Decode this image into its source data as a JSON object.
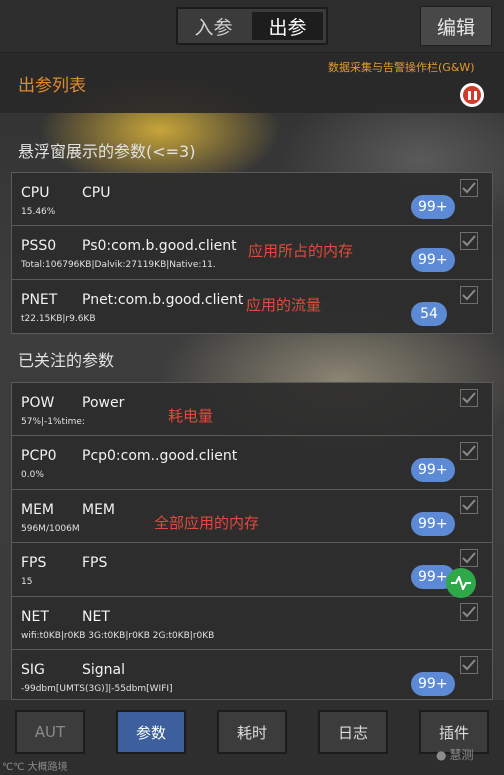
{
  "topbar": {
    "tabs": [
      {
        "label": "入参",
        "active": false
      },
      {
        "label": "出参",
        "active": true
      }
    ],
    "edit_label": "编辑"
  },
  "header": {
    "title": "出参列表",
    "ops_label": "数据采集与告警操作栏(G&W)"
  },
  "sections": {
    "floating": "悬浮窗展示的参数(<=3)",
    "followed": "已关注的参数"
  },
  "floating_params": [
    {
      "code": "CPU",
      "name": "CPU",
      "sub": "15.46%",
      "badge": "99+",
      "note": ""
    },
    {
      "code": "PSS0",
      "name": "Ps0:com.b.good.client",
      "sub": "Total:106796KB|Dalvik:27119KB|Native:11.",
      "badge": "99+",
      "note": "应用所占的内存"
    },
    {
      "code": "PNET",
      "name": "Pnet:com.b.good.client",
      "sub": "t22.15KB|r9.6KB",
      "badge": "54",
      "note": "应用的流量"
    }
  ],
  "followed_params": [
    {
      "code": "POW",
      "name": "Power",
      "sub": "57%|-1%time:",
      "badge": "",
      "note": "耗电量"
    },
    {
      "code": "PCP0",
      "name": "Pcp0:com..good.client",
      "sub": "0.0%",
      "badge": "99+",
      "note": ""
    },
    {
      "code": "MEM",
      "name": "MEM",
      "sub": "596M/1006M",
      "badge": "99+",
      "note": "全部应用的内存"
    },
    {
      "code": "FPS",
      "name": "FPS",
      "sub": "15",
      "badge": "99+",
      "note": ""
    },
    {
      "code": "NET",
      "name": "NET",
      "sub": "wifi:t0KB|r0KB 3G:t0KB|r0KB 2G:t0KB|r0KB",
      "badge": "",
      "note": ""
    },
    {
      "code": "SIG",
      "name": "Signal",
      "sub": "-99dbm[UMTS(3G)]|-55dbm[WIFI]",
      "badge": "99+",
      "note": ""
    }
  ],
  "bottom_tabs": [
    {
      "label": "AUT",
      "state": "dim"
    },
    {
      "label": "参数",
      "state": "active"
    },
    {
      "label": "耗时",
      "state": "normal"
    },
    {
      "label": "日志",
      "state": "normal"
    },
    {
      "label": "插件",
      "state": "normal"
    }
  ],
  "footer": {
    "left": "℃℃ 大概路境",
    "right": "慧测"
  },
  "colors": {
    "accent_orange": "#e08a2a",
    "badge_blue": "#5c8ad4",
    "note_red": "#e14b3b",
    "active_tab": "#3d5f9e",
    "float_green": "#2fa84a"
  }
}
